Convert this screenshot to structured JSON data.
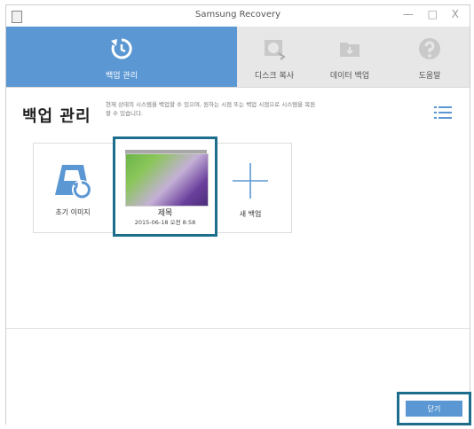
{
  "window": {
    "title": "Samsung Recovery",
    "controls": "— □ X"
  },
  "ribbon": {
    "tabs": [
      {
        "label": "백업 관리",
        "icon": "restore-icon",
        "active": true
      },
      {
        "label": "디스크 복사",
        "icon": "disk-copy-icon",
        "active": false
      },
      {
        "label": "데이터 백업",
        "icon": "data-backup-icon",
        "active": false
      },
      {
        "label": "도움말",
        "icon": "help-icon",
        "active": false
      }
    ]
  },
  "main": {
    "title": "백업 관리",
    "description": "현재 상태의 시스템을 백업할 수 있으며, 원하는 시점 또는 백업 시점으로 시스템을 복원할 수 있습니다.",
    "cards": [
      {
        "label": "초기 이미지"
      },
      {
        "label": "제목",
        "date": "2015-06-18 오전 8:58"
      },
      {
        "label": "새 백업"
      }
    ]
  },
  "footer": {
    "close_label": "닫기"
  },
  "colors": {
    "accent": "#5b97d3",
    "highlight": "#1c6e8c"
  }
}
